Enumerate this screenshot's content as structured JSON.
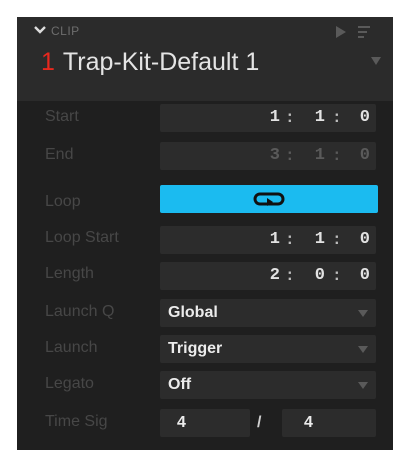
{
  "clip": {
    "section_label": "CLIP",
    "number": "1",
    "name": "Trap-Kit-Default 1"
  },
  "start": {
    "label": "Start",
    "bar": "1",
    "beat": "1",
    "sixteenth": "0"
  },
  "end": {
    "label": "End",
    "bar": "3",
    "beat": "1",
    "sixteenth": "0"
  },
  "loop": {
    "label": "Loop",
    "enabled": true
  },
  "loop_start": {
    "label": "Loop Start",
    "bar": "1",
    "beat": "1",
    "sixteenth": "0"
  },
  "length": {
    "label": "Length",
    "bar": "2",
    "beat": "0",
    "sixteenth": "0"
  },
  "launch_q": {
    "label": "Launch Q",
    "value": "Global"
  },
  "launch": {
    "label": "Launch",
    "value": "Trigger"
  },
  "legato": {
    "label": "Legato",
    "value": "Off"
  },
  "time_sig": {
    "label": "Time Sig",
    "numerator": "4",
    "separator": "/",
    "denominator": "4"
  },
  "colors": {
    "panel_bg": "#1f1f1f",
    "header_bg": "#2b2b2b",
    "field_bg": "#2c2c2c",
    "accent_loop": "#1bbbf0",
    "clip_number": "#e8281e"
  },
  "icons": {
    "collapse": "chevron-down-icon",
    "play": "play-icon",
    "menu": "menu-icon",
    "loop": "loop-icon",
    "dropdown": "triangle-down-icon"
  }
}
